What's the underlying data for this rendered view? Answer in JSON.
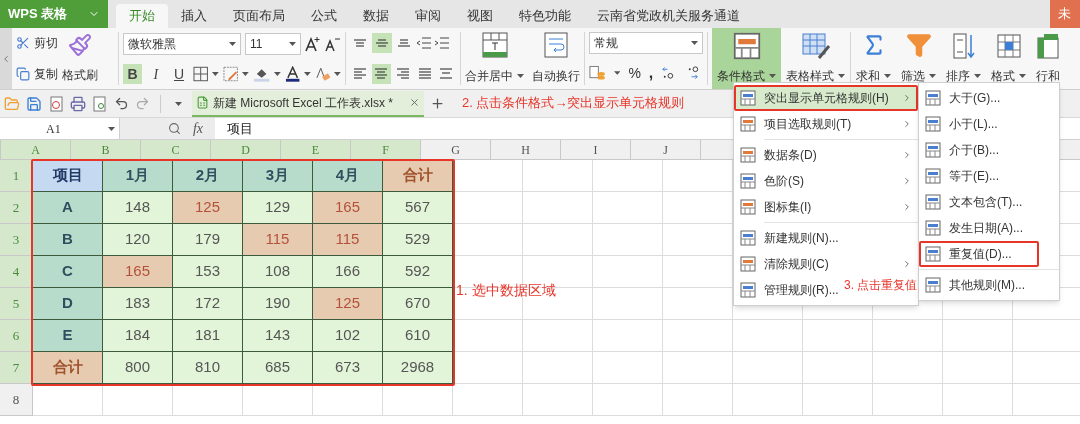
{
  "app_menu": {
    "label": "WPS 表格"
  },
  "tabs": [
    {
      "label": "开始",
      "selected": true
    },
    {
      "label": "插入",
      "selected": false
    },
    {
      "label": "页面布局",
      "selected": false
    },
    {
      "label": "公式",
      "selected": false
    },
    {
      "label": "数据",
      "selected": false
    },
    {
      "label": "审阅",
      "selected": false
    },
    {
      "label": "视图",
      "selected": false
    },
    {
      "label": "特色功能",
      "selected": false
    },
    {
      "label": "云南省党政机关服务通道",
      "selected": false
    }
  ],
  "account": {
    "label": "未"
  },
  "ribbon": {
    "clipboard": {
      "cut": "剪切",
      "copy": "复制",
      "format_painter": "格式刷"
    },
    "font": {
      "name": "微软雅黑",
      "size": "11",
      "styles": [
        {
          "label": "B",
          "selected": true
        },
        {
          "label": "I",
          "selected": false
        },
        {
          "label": "U",
          "selected": false
        }
      ]
    },
    "vertical_align": [
      {
        "kind": "top",
        "selected": false
      },
      {
        "kind": "middle",
        "selected": true
      },
      {
        "kind": "bottom",
        "selected": false
      }
    ],
    "horizontal_align": [
      {
        "kind": "left",
        "selected": false
      },
      {
        "kind": "center",
        "selected": true
      },
      {
        "kind": "right",
        "selected": false
      },
      {
        "kind": "justify",
        "selected": false
      },
      {
        "kind": "distributed",
        "selected": false
      }
    ],
    "alignment": {
      "merge": "合并居中",
      "wrap": "自动换行"
    },
    "number": {
      "format": "常规",
      "percent": "%",
      "comma": ","
    },
    "tools": [
      {
        "label": "条件格式",
        "kind": "conditional",
        "selected": true,
        "dropdown": true
      },
      {
        "label": "表格样式",
        "kind": "table_style",
        "selected": false,
        "dropdown": true
      },
      {
        "label": "求和",
        "kind": "sum",
        "selected": false,
        "dropdown": true
      },
      {
        "label": "筛选",
        "kind": "filter",
        "selected": false,
        "dropdown": true
      },
      {
        "label": "排序",
        "kind": "sort",
        "selected": false,
        "dropdown": true
      },
      {
        "label": "格式",
        "kind": "format",
        "selected": false,
        "dropdown": true
      },
      {
        "label": "行和",
        "kind": "rows_columns",
        "selected": false,
        "dropdown": false
      }
    ]
  },
  "document_tab": {
    "title": "新建 Microsoft Excel 工作表.xlsx *"
  },
  "formula_bar": {
    "cell_ref": "A1",
    "fx": "fx",
    "value": "项目"
  },
  "sheet": {
    "outlined": true,
    "columns": [
      {
        "label": "A",
        "selected": true
      },
      {
        "label": "B",
        "selected": true
      },
      {
        "label": "C",
        "selected": true
      },
      {
        "label": "D",
        "selected": true
      },
      {
        "label": "E",
        "selected": true
      },
      {
        "label": "F",
        "selected": true
      },
      {
        "label": "G",
        "selected": false
      },
      {
        "label": "H",
        "selected": false
      },
      {
        "label": "I",
        "selected": false
      },
      {
        "label": "J",
        "selected": false
      }
    ],
    "rows": [
      {
        "label": "1",
        "selected": true,
        "cells": [
          {
            "text": "项目",
            "kind": "corner",
            "highlighted": false
          },
          {
            "text": "1月",
            "kind": "header",
            "highlighted": false
          },
          {
            "text": "2月",
            "kind": "header",
            "highlighted": false
          },
          {
            "text": "3月",
            "kind": "header",
            "highlighted": false
          },
          {
            "text": "4月",
            "kind": "header",
            "highlighted": false
          },
          {
            "text": "合计",
            "kind": "total",
            "highlighted": false
          }
        ]
      },
      {
        "label": "2",
        "selected": true,
        "cells": [
          {
            "text": "A",
            "kind": "header",
            "highlighted": false
          },
          {
            "text": "148",
            "kind": "value",
            "highlighted": false
          },
          {
            "text": "125",
            "kind": "value",
            "highlighted": true
          },
          {
            "text": "129",
            "kind": "value",
            "highlighted": false
          },
          {
            "text": "165",
            "kind": "value",
            "highlighted": true
          },
          {
            "text": "567",
            "kind": "value",
            "highlighted": false
          }
        ]
      },
      {
        "label": "3",
        "selected": true,
        "cells": [
          {
            "text": "B",
            "kind": "header",
            "highlighted": false
          },
          {
            "text": "120",
            "kind": "value",
            "highlighted": false
          },
          {
            "text": "179",
            "kind": "value",
            "highlighted": false
          },
          {
            "text": "115",
            "kind": "value",
            "highlighted": true
          },
          {
            "text": "115",
            "kind": "value",
            "highlighted": true
          },
          {
            "text": "529",
            "kind": "value",
            "highlighted": false
          }
        ]
      },
      {
        "label": "4",
        "selected": true,
        "cells": [
          {
            "text": "C",
            "kind": "header",
            "highlighted": false
          },
          {
            "text": "165",
            "kind": "value",
            "highlighted": true
          },
          {
            "text": "153",
            "kind": "value",
            "highlighted": false
          },
          {
            "text": "108",
            "kind": "value",
            "highlighted": false
          },
          {
            "text": "166",
            "kind": "value",
            "highlighted": false
          },
          {
            "text": "592",
            "kind": "value",
            "highlighted": false
          }
        ]
      },
      {
        "label": "5",
        "selected": true,
        "cells": [
          {
            "text": "D",
            "kind": "header",
            "highlighted": false
          },
          {
            "text": "183",
            "kind": "value",
            "highlighted": false
          },
          {
            "text": "172",
            "kind": "value",
            "highlighted": false
          },
          {
            "text": "190",
            "kind": "value",
            "highlighted": false
          },
          {
            "text": "125",
            "kind": "value",
            "highlighted": true
          },
          {
            "text": "670",
            "kind": "value",
            "highlighted": false
          }
        ]
      },
      {
        "label": "6",
        "selected": true,
        "cells": [
          {
            "text": "E",
            "kind": "header",
            "highlighted": false
          },
          {
            "text": "184",
            "kind": "value",
            "highlighted": false
          },
          {
            "text": "181",
            "kind": "value",
            "highlighted": false
          },
          {
            "text": "143",
            "kind": "value",
            "highlighted": false
          },
          {
            "text": "102",
            "kind": "value",
            "highlighted": false
          },
          {
            "text": "610",
            "kind": "value",
            "highlighted": false
          }
        ]
      },
      {
        "label": "7",
        "selected": true,
        "cells": [
          {
            "text": "合计",
            "kind": "total",
            "highlighted": false
          },
          {
            "text": "800",
            "kind": "value",
            "highlighted": false
          },
          {
            "text": "810",
            "kind": "value",
            "highlighted": false
          },
          {
            "text": "685",
            "kind": "value",
            "highlighted": false
          },
          {
            "text": "673",
            "kind": "value",
            "highlighted": false
          },
          {
            "text": "2968",
            "kind": "value",
            "highlighted": false
          }
        ]
      },
      {
        "label": "8",
        "selected": false,
        "cells": []
      }
    ]
  },
  "menu": {
    "groups": [
      [
        {
          "label": "突出显示单元格规则(H)",
          "submenu": true,
          "selected": true,
          "outlined": true
        },
        {
          "label": "项目选取规则(T)",
          "submenu": true,
          "selected": false,
          "outlined": false
        }
      ],
      [
        {
          "label": "数据条(D)",
          "submenu": true,
          "selected": false,
          "outlined": false
        },
        {
          "label": "色阶(S)",
          "submenu": true,
          "selected": false,
          "outlined": false
        },
        {
          "label": "图标集(I)",
          "submenu": true,
          "selected": false,
          "outlined": false
        }
      ],
      [
        {
          "label": "新建规则(N)...",
          "submenu": false,
          "selected": false,
          "outlined": false
        },
        {
          "label": "清除规则(C)",
          "submenu": true,
          "selected": false,
          "outlined": false
        },
        {
          "label": "管理规则(R)...",
          "submenu": false,
          "selected": false,
          "outlined": false
        }
      ]
    ]
  },
  "submenu": {
    "groups": [
      [
        {
          "label": "大于(G)...",
          "outlined": false
        },
        {
          "label": "小于(L)...",
          "outlined": false
        },
        {
          "label": "介于(B)...",
          "outlined": false
        },
        {
          "label": "等于(E)...",
          "outlined": false
        },
        {
          "label": "文本包含(T)...",
          "outlined": false
        },
        {
          "label": "发生日期(A)...",
          "outlined": false
        },
        {
          "label": "重复值(D)...",
          "outlined": true
        }
      ],
      [
        {
          "label": "其他规则(M)...",
          "outlined": false
        }
      ]
    ]
  },
  "annotations": [
    "2. 点击条件格式→突出显示单元格规则",
    "1. 选中数据区域",
    "3. 点击重复值"
  ]
}
